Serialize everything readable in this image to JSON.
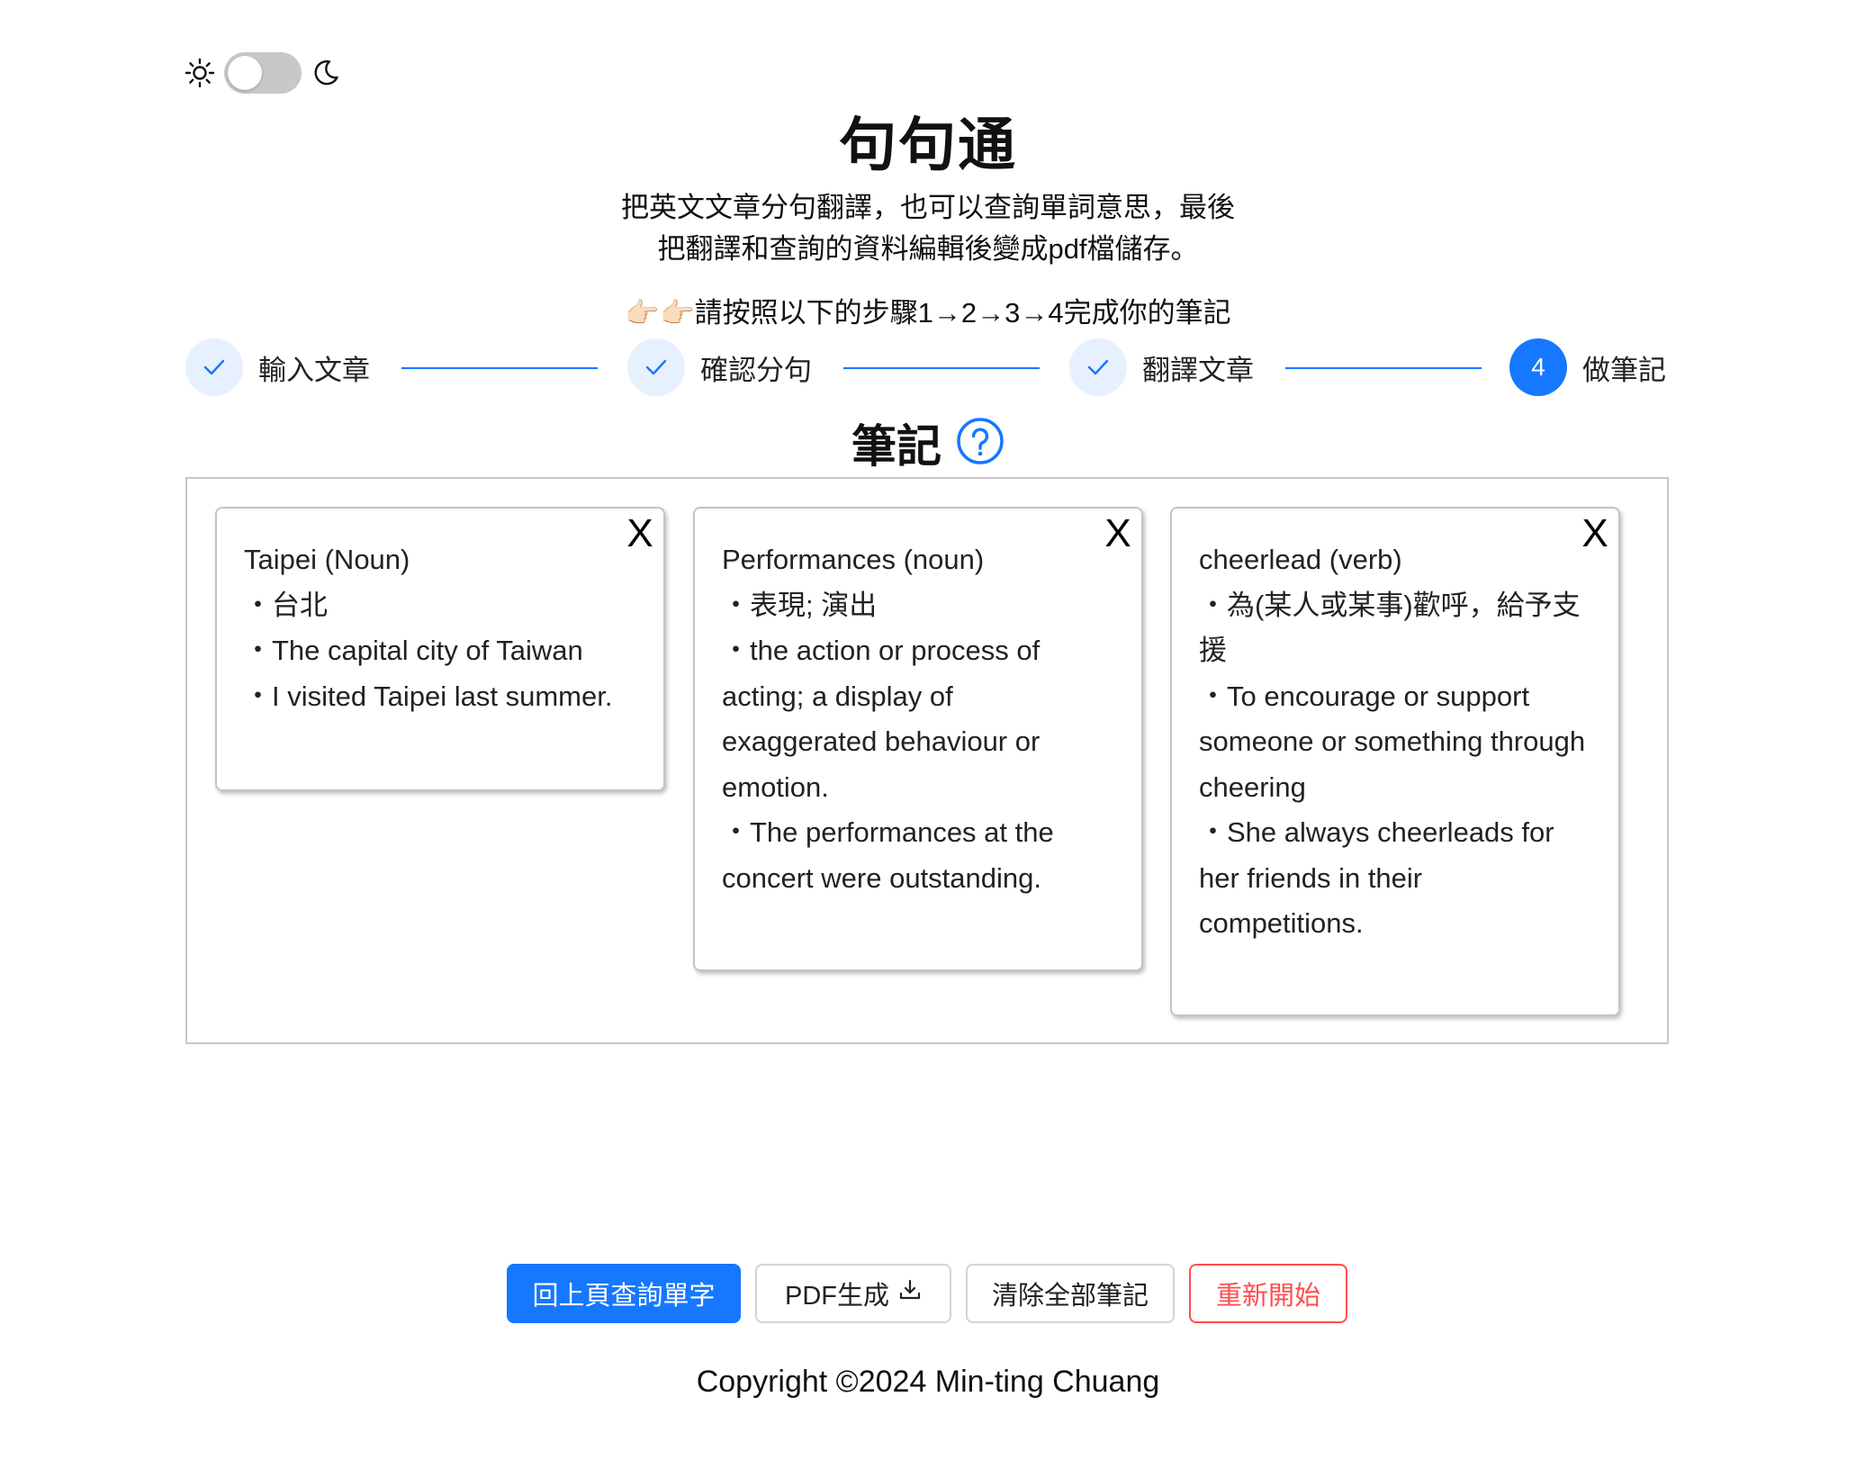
{
  "app": {
    "title": "句句通",
    "subtitle": "把英文文章分句翻譯，也可以查詢單詞意思，最後把翻譯和查詢的資料編輯後變成pdf檔儲存。",
    "instruction": "👉🏻👉🏻請按照以下的步驟1→2→3→4完成你的筆記"
  },
  "theme": {
    "sun_icon": "sun-icon",
    "moon_icon": "moon-icon",
    "mode": "light"
  },
  "steps": [
    {
      "label": "輸入文章",
      "status": "done"
    },
    {
      "label": "確認分句",
      "status": "done"
    },
    {
      "label": "翻譯文章",
      "status": "done"
    },
    {
      "label": "做筆記",
      "status": "active",
      "number": "4"
    }
  ],
  "notes": {
    "heading": "筆記",
    "close_label": "X",
    "cards": [
      {
        "word": "Taipei (Noun)",
        "translation": "台北",
        "definition": "The capital city of Taiwan",
        "example": "I visited Taipei last summer."
      },
      {
        "word": "Performances (noun)",
        "translation": "表現; 演出",
        "definition": "the action or process of acting; a display of exaggerated behaviour or emotion.",
        "example": "The performances at the concert were outstanding."
      },
      {
        "word": "cheerlead (verb)",
        "translation": "為(某人或某事)歡呼，給予支援",
        "definition": "To encourage or support someone or something through cheering",
        "example": "She always cheerleads for her friends in their competitions."
      }
    ]
  },
  "actions": {
    "back_label": "回上頁查詢單字",
    "pdf_label": "PDF生成",
    "clear_label": "清除全部筆記",
    "restart_label": "重新開始"
  },
  "footer": {
    "copyright": "Copyright ©2024 Min-ting Chuang"
  },
  "colors": {
    "primary": "#1677ff",
    "danger": "#ff4d4f",
    "step_done_bg": "#e6f0ff"
  }
}
